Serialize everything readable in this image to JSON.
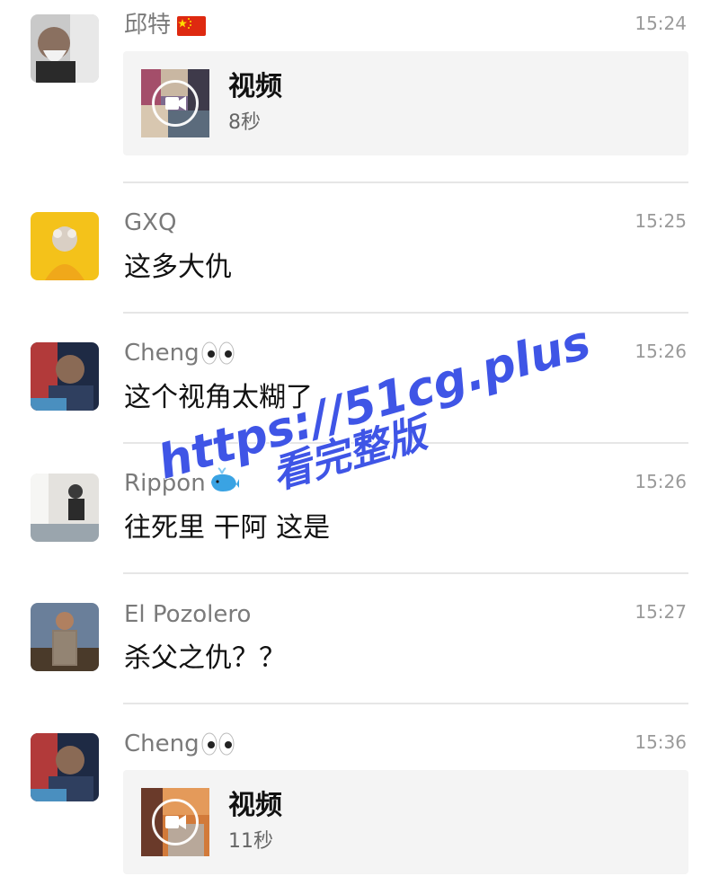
{
  "messages": [
    {
      "name": "邱特",
      "time": "15:24",
      "video_label": "视频",
      "video_duration": "8秒"
    },
    {
      "name": "GXQ",
      "time": "15:25",
      "text": "这多大仇"
    },
    {
      "name": "Cheng",
      "time": "15:26",
      "text": "这个视角太糊了"
    },
    {
      "name": "Rippon",
      "time": "15:26",
      "text": "往死里 干阿 这是"
    },
    {
      "name": "El Pozolero",
      "time": "15:27",
      "text": "杀父之仇？？"
    },
    {
      "name": "Cheng",
      "time": "15:36",
      "video_label": "视频",
      "video_duration": "11秒"
    }
  ],
  "watermark": {
    "url": "https://51cg.plus",
    "subtitle": "看完整版"
  },
  "colors": {
    "watermark": "#3f55e6",
    "name": "#7a7a7a",
    "text": "#111111",
    "card": "#f4f4f4"
  },
  "icons": {
    "flag": "china-flag-icon",
    "eyes": "eyes-icon",
    "whale": "whale-icon",
    "video": "video-camera-icon"
  }
}
